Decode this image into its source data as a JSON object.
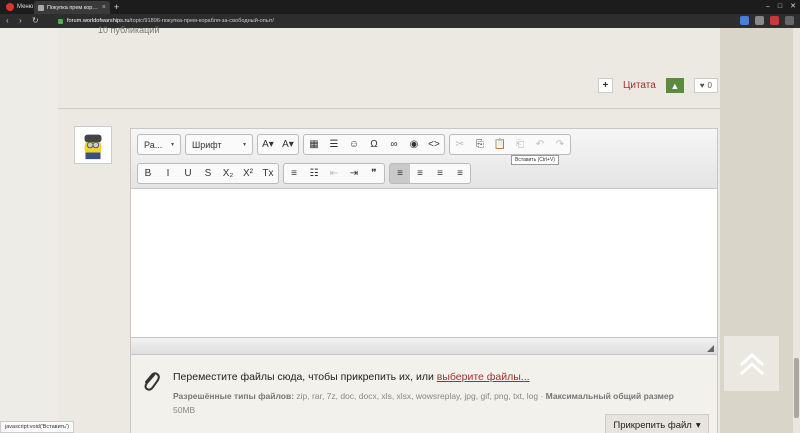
{
  "browser": {
    "menu_label": "Меню",
    "tab_title": "Покупка прем корабля за свободный опыт",
    "tab_close": "×",
    "new_tab": "+",
    "url_host": "forum.worldofwarships.ru",
    "url_path": "/topic/91896-покупка-прем-корабля-за-свободный-опыт/",
    "nav_back": "‹",
    "nav_forward": "›",
    "nav_reload": "↻",
    "win_min": "–",
    "win_max": "□",
    "win_close": "✕"
  },
  "post": {
    "prev_text": "10 публикаций",
    "quote_label": "Цитата",
    "plus_label": "+",
    "upvote_label": "▲",
    "like_icon": "♥",
    "like_count": "0"
  },
  "editor": {
    "format_combo": "Ра...",
    "font_combo": "Шрифт",
    "combo_arrow": "▾",
    "tooltip": "Вставить (Ctrl+V)",
    "row1": [
      {
        "name": "text-color-button",
        "glyph": "A▾"
      },
      {
        "name": "bg-color-button",
        "glyph": "A▾"
      },
      {
        "name": "table-button",
        "glyph": "▦"
      },
      {
        "name": "horizontal-rule-button",
        "glyph": "☰"
      },
      {
        "name": "emoticon-button",
        "glyph": "☺"
      },
      {
        "name": "special-char-button",
        "glyph": "Ω"
      },
      {
        "name": "link-button",
        "glyph": "∞"
      },
      {
        "name": "preview-button",
        "glyph": "◉"
      },
      {
        "name": "source-button",
        "glyph": "<>"
      },
      {
        "name": "cut-button",
        "glyph": "✂"
      },
      {
        "name": "copy-button",
        "glyph": "⎘"
      },
      {
        "name": "paste-button",
        "glyph": "📋"
      },
      {
        "name": "paste-text-button",
        "glyph": "⎗"
      },
      {
        "name": "undo-button",
        "glyph": "↶"
      },
      {
        "name": "redo-button",
        "glyph": "↷"
      }
    ],
    "row2": [
      {
        "name": "bold-button",
        "glyph": "B"
      },
      {
        "name": "italic-button",
        "glyph": "I"
      },
      {
        "name": "underline-button",
        "glyph": "U"
      },
      {
        "name": "strike-button",
        "glyph": "S"
      },
      {
        "name": "subscript-button",
        "glyph": "X₂"
      },
      {
        "name": "superscript-button",
        "glyph": "X²"
      },
      {
        "name": "remove-format-button",
        "glyph": "Tx"
      },
      {
        "name": "numbered-list-button",
        "glyph": "≡"
      },
      {
        "name": "bullet-list-button",
        "glyph": "☷"
      },
      {
        "name": "outdent-button",
        "glyph": "⇤"
      },
      {
        "name": "indent-button",
        "glyph": "⇥"
      },
      {
        "name": "blockquote-button",
        "glyph": "❞"
      },
      {
        "name": "align-left-button",
        "glyph": "≡"
      },
      {
        "name": "align-center-button",
        "glyph": "≡"
      },
      {
        "name": "align-right-button",
        "glyph": "≡"
      },
      {
        "name": "justify-button",
        "glyph": "≡"
      }
    ]
  },
  "attach": {
    "message": "Переместите файлы сюда, чтобы прикрепить их, или ",
    "link_text": "выберите файлы...",
    "types_label": "Разрешённые типы файлов:",
    "types_list": " zip, rar, 7z, doc, docx, xls, xlsx, wowsreplay, jpg, gif, png, txt, log · ",
    "max_label": "Максимальный общий размер",
    "max_value": "50MB",
    "button_label": "Прикрепить файл",
    "button_arrow": "▾"
  },
  "status_url": "javascript:void('Вставить')",
  "colors": {
    "accent": "#a0312b",
    "upvote": "#5b8c3e"
  }
}
